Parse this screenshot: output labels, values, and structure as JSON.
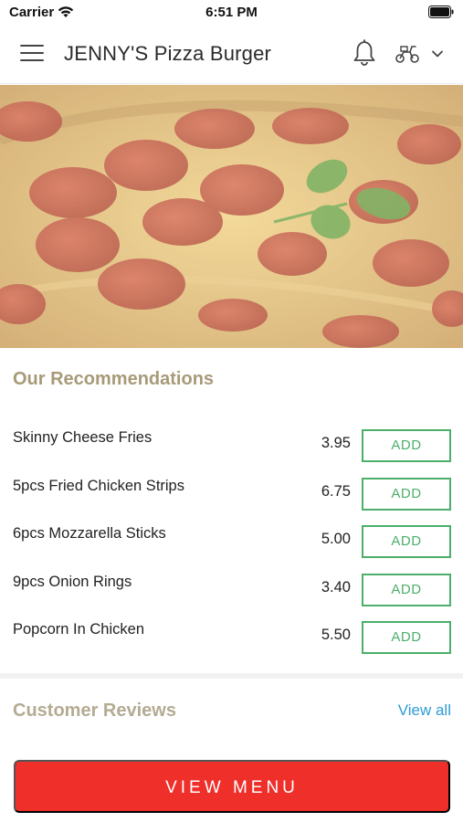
{
  "status_bar": {
    "carrier": "Carrier",
    "time": "6:51 PM"
  },
  "header": {
    "title": "JENNY'S Pizza Burger",
    "icons": [
      "menu-icon",
      "bell-icon",
      "scooter-icon",
      "chevron-down-icon"
    ]
  },
  "recommendations": {
    "heading": "Our Recommendations",
    "items": [
      {
        "name": "Skinny Cheese Fries",
        "price": "3.95",
        "button": "ADD"
      },
      {
        "name": "5pcs Fried Chicken Strips",
        "price": "6.75",
        "button": "ADD"
      },
      {
        "name": "6pcs Mozzarella Sticks",
        "price": "5.00",
        "button": "ADD"
      },
      {
        "name": "9pcs Onion Rings",
        "price": "3.40",
        "button": "ADD"
      },
      {
        "name": "Popcorn In Chicken",
        "price": "5.50",
        "button": "ADD"
      }
    ]
  },
  "reviews": {
    "heading": "Customer Reviews",
    "view_all": "View all"
  },
  "footer": {
    "button": "VIEW MENU"
  },
  "colors": {
    "accent_green": "#4caf6a",
    "button_red": "#ee2f2a",
    "link_blue": "#2e9bd6",
    "heading_tan": "#a89a78"
  }
}
